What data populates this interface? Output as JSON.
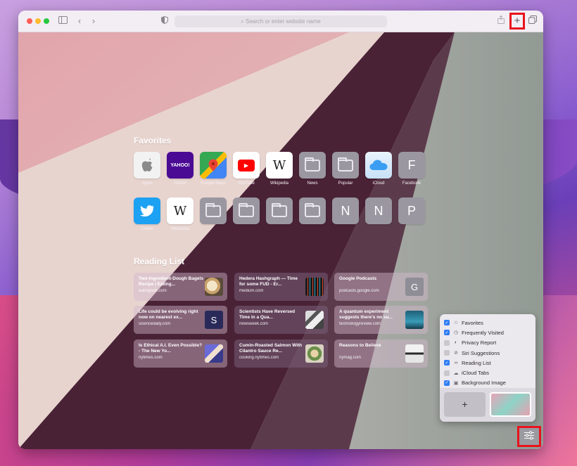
{
  "toolbar": {
    "address_placeholder": "Search or enter website name",
    "sidebar_icon": "sidebar-icon",
    "new_tab_label": "+"
  },
  "favorites": {
    "title": "Favorites",
    "items": [
      {
        "label": "Apple",
        "glyph": ""
      },
      {
        "label": "Yahoo!",
        "glyph": "YAHOO!"
      },
      {
        "label": "Google Maps",
        "glyph": ""
      },
      {
        "label": "YouTube",
        "glyph": "▶"
      },
      {
        "label": "Wikipedia",
        "glyph": "W"
      },
      {
        "label": "News",
        "glyph": ""
      },
      {
        "label": "Popular",
        "glyph": ""
      },
      {
        "label": "iCloud",
        "glyph": ""
      },
      {
        "label": "Facebook",
        "glyph": "F"
      },
      {
        "label": "Twitter",
        "glyph": ""
      },
      {
        "label": "Wikipedia",
        "glyph": "W"
      },
      {
        "label": "",
        "glyph": ""
      },
      {
        "label": "",
        "glyph": ""
      },
      {
        "label": "",
        "glyph": ""
      },
      {
        "label": "",
        "glyph": ""
      },
      {
        "label": "",
        "glyph": "N"
      },
      {
        "label": "",
        "glyph": "N"
      },
      {
        "label": "",
        "glyph": "P"
      }
    ]
  },
  "reading_list": {
    "title": "Reading List",
    "items": [
      {
        "title": "Two-Ingredient-Dough Bagels Recipe | Eating...",
        "source": "eatingwell.com",
        "thumb": ""
      },
      {
        "title": "Hedera Hashgraph — Time for some FUD - Er...",
        "source": "medium.com",
        "thumb": ""
      },
      {
        "title": "Google Podcasts",
        "source": "podcasts.google.com",
        "thumb": "G"
      },
      {
        "title": "Life could be evolving right now on nearest ex...",
        "source": "sciencedaily.com",
        "thumb": "S"
      },
      {
        "title": "Scientists Have Reversed Time in a Qua...",
        "source": "newsweek.com",
        "thumb": ""
      },
      {
        "title": "A quantum experiment suggests there's no su...",
        "source": "technologyreview.com",
        "thumb": ""
      },
      {
        "title": "Is Ethical A.I. Even Possible? - The New Yo...",
        "source": "nytimes.com",
        "thumb": ""
      },
      {
        "title": "Cumin-Roasted Salmon With Cilantro Sauce Re...",
        "source": "cooking.nytimes.com",
        "thumb": ""
      },
      {
        "title": "Reasons to Believe",
        "source": "nymag.com",
        "thumb": ""
      }
    ]
  },
  "customize_panel": {
    "options": [
      {
        "label": "Favorites",
        "checked": true,
        "icon": "star-icon",
        "glyph": "☆"
      },
      {
        "label": "Frequently Visited",
        "checked": true,
        "icon": "clock-icon",
        "glyph": "◷"
      },
      {
        "label": "Privacy Report",
        "checked": false,
        "icon": "shield-icon",
        "glyph": "◐"
      },
      {
        "label": "Siri Suggestions",
        "checked": false,
        "icon": "siri-icon",
        "glyph": "⊘"
      },
      {
        "label": "Reading List",
        "checked": true,
        "icon": "glasses-icon",
        "glyph": "∞"
      },
      {
        "label": "iCloud Tabs",
        "checked": false,
        "icon": "cloud-icon",
        "glyph": "☁"
      },
      {
        "label": "Background Image",
        "checked": true,
        "icon": "image-icon",
        "glyph": "▣"
      }
    ],
    "add_background_label": "+"
  },
  "colors": {
    "highlight": "#e8131d",
    "checkbox_on": "#2f7df6"
  }
}
